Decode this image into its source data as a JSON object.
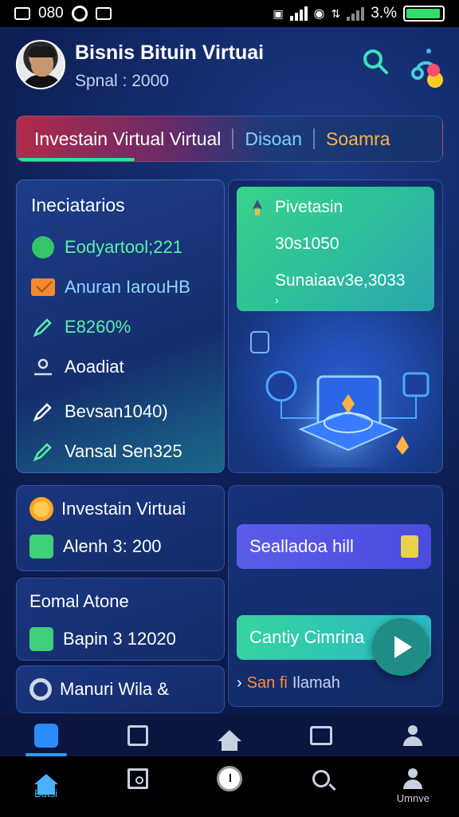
{
  "status_bar": {
    "time": "080",
    "battery_percent_label": "3.%",
    "battery_level": 0.95,
    "accent_battery": "#2ee06a"
  },
  "header": {
    "title": "Bisnis Bituin Virtuai",
    "subtitle": "Spnal : 2000",
    "icons": [
      "avatar",
      "search-icon",
      "share-icon"
    ]
  },
  "tabs": [
    {
      "label": "Investain Virtual Virtual",
      "active": true,
      "color": "#ffffff"
    },
    {
      "label": "Disoan",
      "active": false,
      "color": "#7fd0ff"
    },
    {
      "label": "Soamra",
      "active": false,
      "color": "#ffb347"
    }
  ],
  "info_card": {
    "title": "Ineciatarios",
    "rows": [
      {
        "icon": "badge-icon",
        "text": "Eodyartool;221",
        "color": "#5bf0a8"
      },
      {
        "icon": "envelope-icon",
        "text": "Anuran IarouHB",
        "color": "#8fd6ff"
      },
      {
        "icon": "pencil-icon",
        "text": "E8260%",
        "color": "#5bf0a8"
      },
      {
        "icon": "user-icon",
        "text": "Aoadiat",
        "color": "#ffffff"
      },
      {
        "icon": "pencil-icon",
        "text": "Bevsan1040)",
        "color": "#ffffff"
      },
      {
        "icon": "pencil-icon",
        "text": "Vansal Sen325",
        "color": "#ffffff"
      }
    ]
  },
  "feature_card": {
    "title": "Pivetasin",
    "line1": "30s1050",
    "line2": "Sunaiaav3e,3033",
    "chevron": "›"
  },
  "small_cards": [
    {
      "icon": "coin-icon",
      "title": "Investain Virtuai",
      "sub_icon": "check-icon",
      "sub": "Alenh 3: 200"
    },
    {
      "icon": "",
      "title": "Eomal Atone",
      "sub_icon": "grid-icon",
      "sub": "Bapin 3 12020"
    },
    {
      "icon": "settings-icon",
      "title": "Manuri Wila &",
      "sub_icon": "",
      "sub": ""
    }
  ],
  "actions": {
    "purple_button": "Sealladoa hill",
    "green_button": "Cantiy Cimrina",
    "link_prefix": "›",
    "link_orange": "San fi",
    "link_muted": "Ilamah"
  },
  "upper_bar": [
    "wallet-icon",
    "frame-icon",
    "home-icon",
    "calendar-icon",
    "user-icon"
  ],
  "bottom_nav": [
    {
      "icon": "home-icon",
      "label": "Bdtsi",
      "active": true
    },
    {
      "icon": "square-icon",
      "label": "",
      "active": false
    },
    {
      "icon": "clock-icon",
      "label": "",
      "active": false
    },
    {
      "icon": "search-icon",
      "label": "",
      "active": false
    },
    {
      "icon": "user-icon",
      "label": "Umnve",
      "active": false
    }
  ]
}
